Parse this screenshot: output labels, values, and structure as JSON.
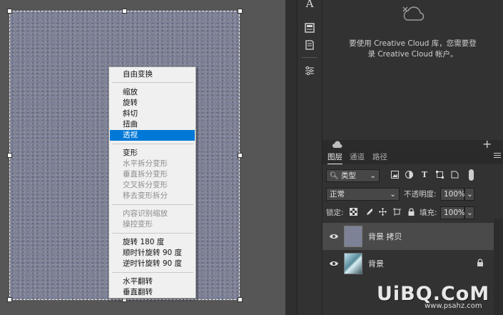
{
  "context_menu": {
    "items": [
      {
        "label": "自由变换",
        "disabled": false
      },
      {
        "label": "缩放",
        "disabled": false
      },
      {
        "label": "旋转",
        "disabled": false
      },
      {
        "label": "斜切",
        "disabled": false
      },
      {
        "label": "扭曲",
        "disabled": false
      },
      {
        "label": "透视",
        "disabled": false,
        "selected": true
      },
      {
        "label": "变形",
        "disabled": false
      },
      {
        "label": "水平拆分变形",
        "disabled": true
      },
      {
        "label": "垂直拆分变形",
        "disabled": true
      },
      {
        "label": "交叉拆分变形",
        "disabled": true
      },
      {
        "label": "移去变形拆分",
        "disabled": true
      },
      {
        "label": "内容识别缩放",
        "disabled": true
      },
      {
        "label": "操控变形",
        "disabled": true
      },
      {
        "label": "旋转 180 度",
        "disabled": false
      },
      {
        "label": "顺时针旋转 90 度",
        "disabled": false
      },
      {
        "label": "逆时针旋转 90 度",
        "disabled": false
      },
      {
        "label": "水平翻转",
        "disabled": false
      },
      {
        "label": "垂直翻转",
        "disabled": false
      }
    ]
  },
  "libraries": {
    "message_line1": "要使用 Creative Cloud 库，您需要登",
    "message_line2": "录 Creative Cloud 帐户。"
  },
  "layers_panel": {
    "tabs": [
      "图层",
      "通道",
      "路径"
    ],
    "active_tab": "图层",
    "filter_kind": "类型",
    "blend_mode": "正常",
    "opacity_label": "不透明度:",
    "opacity_value": "100%",
    "lock_label": "锁定:",
    "fill_label": "填充:",
    "fill_value": "100%",
    "layers": [
      {
        "name": "背景 拷贝",
        "selected": true,
        "locked": false
      },
      {
        "name": "背景",
        "selected": false,
        "locked": true
      }
    ]
  },
  "watermark": {
    "text": "UiBQ.CoM",
    "subtext": "www.psahz.com"
  },
  "colors": {
    "menu_highlight": "#0078d7",
    "panel_bg": "#323232",
    "canvas_texture": "#7e8296"
  }
}
